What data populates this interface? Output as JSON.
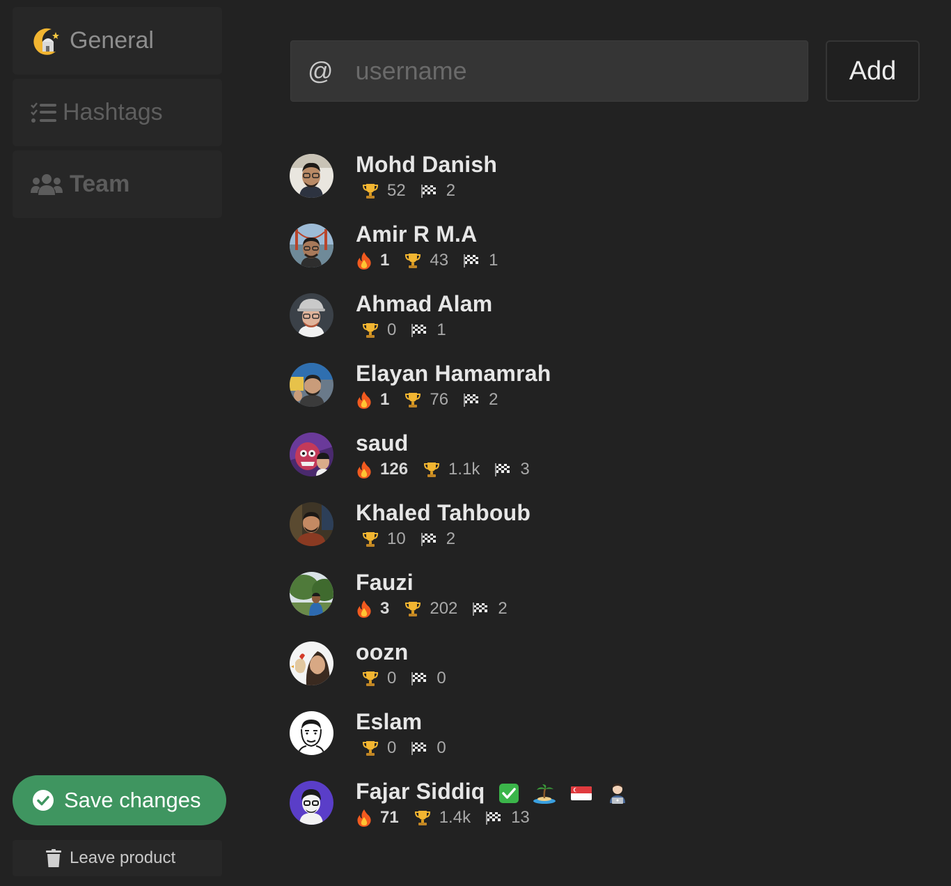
{
  "sidebar": {
    "items": [
      {
        "label": "General",
        "icon": "moon-mosque-icon"
      },
      {
        "label": "Hashtags",
        "icon": "list-check-icon"
      },
      {
        "label": "Team",
        "icon": "users-icon"
      }
    ],
    "save_label": "Save changes",
    "leave_label": "Leave product"
  },
  "add_member": {
    "prefix": "@",
    "placeholder": "username",
    "button_label": "Add"
  },
  "members": [
    {
      "name": "Mohd Danish",
      "streak": null,
      "trophies": "52",
      "launches": "2"
    },
    {
      "name": "Amir R M.A",
      "streak": "1",
      "trophies": "43",
      "launches": "1"
    },
    {
      "name": "Ahmad Alam",
      "streak": null,
      "trophies": "0",
      "launches": "1"
    },
    {
      "name": "Elayan Hamamrah",
      "streak": "1",
      "trophies": "76",
      "launches": "2"
    },
    {
      "name": "saud",
      "streak": "126",
      "trophies": "1.1k",
      "launches": "3"
    },
    {
      "name": "Khaled Tahboub",
      "streak": null,
      "trophies": "10",
      "launches": "2"
    },
    {
      "name": "Fauzi",
      "streak": "3",
      "trophies": "202",
      "launches": "2"
    },
    {
      "name": "oozn",
      "streak": null,
      "trophies": "0",
      "launches": "0"
    },
    {
      "name": "Eslam",
      "streak": null,
      "trophies": "0",
      "launches": "0"
    },
    {
      "name": "Fajar Siddiq",
      "streak": "71",
      "trophies": "1.4k",
      "launches": "13",
      "badges": [
        "check-mark-icon",
        "island-icon",
        "singapore-flag-icon",
        "technologist-icon"
      ]
    }
  ],
  "colors": {
    "background": "#222222",
    "panel": "#272727",
    "save_green": "#3f9560",
    "input_bg": "#353535"
  }
}
